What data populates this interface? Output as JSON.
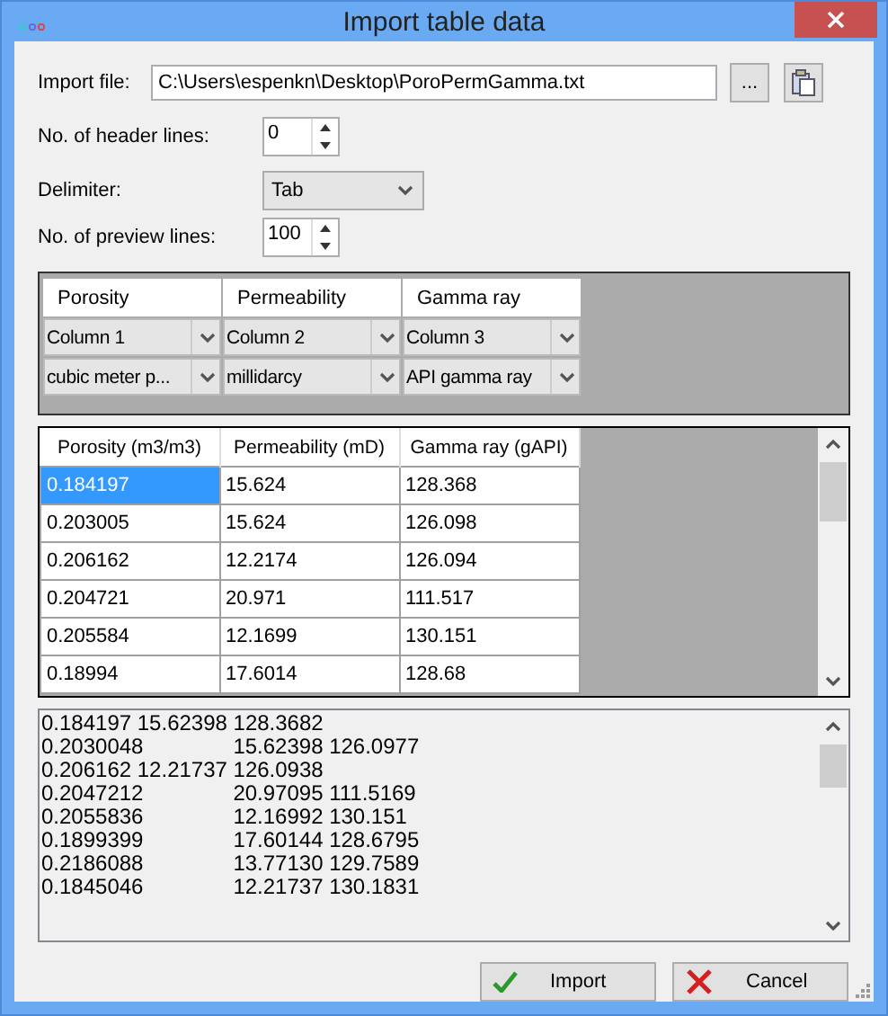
{
  "window": {
    "title": "Import table data"
  },
  "import_file": {
    "label": "Import file:",
    "value": "C:\\Users\\espenkn\\Desktop\\PoroPermGamma.txt",
    "browse": "..."
  },
  "header_lines": {
    "label": "No. of header lines:",
    "value": "0"
  },
  "delimiter": {
    "label": "Delimiter:",
    "value": "Tab"
  },
  "preview_lines": {
    "label": "No. of preview lines:",
    "value": "100"
  },
  "mapping": [
    {
      "name": "Porosity",
      "column": "Column 1",
      "unit": "cubic meter p..."
    },
    {
      "name": "Permeability",
      "column": "Column 2",
      "unit": "millidarcy"
    },
    {
      "name": "Gamma ray",
      "column": "Column 3",
      "unit": "API gamma ray"
    }
  ],
  "table": {
    "columns": [
      "Porosity (m3/m3)",
      "Permeability (mD)",
      "Gamma ray (gAPI)"
    ],
    "rows": [
      {
        "cells": [
          "0.184197",
          "15.624",
          "128.368"
        ],
        "selected": true
      },
      {
        "cells": [
          "0.203005",
          "15.624",
          "126.098"
        ],
        "selected": false
      },
      {
        "cells": [
          "0.206162",
          "12.2174",
          "126.094"
        ],
        "selected": false
      },
      {
        "cells": [
          "0.204721",
          "20.971",
          "111.517"
        ],
        "selected": false
      },
      {
        "cells": [
          "0.205584",
          "12.1699",
          "130.151"
        ],
        "selected": false
      },
      {
        "cells": [
          "0.18994",
          "17.6014",
          "128.68"
        ],
        "selected": false
      }
    ]
  },
  "raw_lines": [
    "0.184197 15.62398 128.3682",
    "0.2030048\t15.62398 126.0977",
    "0.206162 12.21737 126.0938",
    "0.2047212\t20.97095 111.5169",
    "0.2055836\t12.16992 130.151",
    "0.1899399\t17.60144 128.6795",
    "0.2186088\t13.77130 129.7589",
    "0.1845046\t12.21737 130.1831"
  ],
  "buttons": [
    {
      "label": "Import",
      "kind": "ok"
    },
    {
      "label": "Cancel",
      "kind": "cancel"
    }
  ]
}
